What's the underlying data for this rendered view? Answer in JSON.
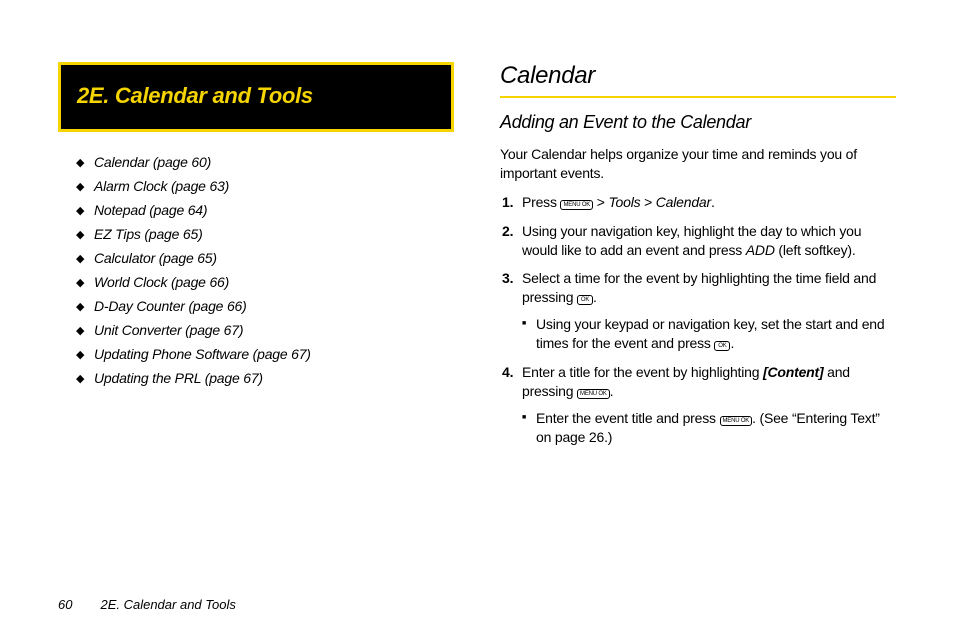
{
  "title": "2E.  Calendar and Tools",
  "bullets": [
    "Calendar (page 60)",
    "Alarm Clock (page 63)",
    "Notepad (page 64)",
    "EZ Tips (page 65)",
    "Calculator (page 65)",
    "World Clock (page 66)",
    "D-Day Counter (page 66)",
    "Unit Converter (page 67)",
    "Updating Phone Software (page 67)",
    "Updating the PRL (page 67)"
  ],
  "section": "Calendar",
  "subheading": "Adding an Event to the Calendar",
  "intro": "Your Calendar helps organize your time and reminds you of important events.",
  "key_menuok": "MENU\nOK",
  "key_ok": "OK",
  "step1_a": "Press ",
  "step1_b": " > ",
  "step1_tools": "Tools",
  "step1_gt": " > ",
  "step1_calendar": "Calendar",
  "step1_end": ".",
  "step2_a": "Using your navigation key, highlight the day to which you would like to add an event and press ",
  "step2_add": "ADD",
  "step2_b": " (left softkey).",
  "step3_a": "Select a time for the event by highlighting the time field and pressing ",
  "step3_end": ".",
  "step3_sub_a": "Using your keypad or navigation key, set the start and end times for the event and press ",
  "step3_sub_end": ".",
  "step4_a": "Enter a title for the event by highlighting ",
  "step4_content": "[Content]",
  "step4_b": " and pressing ",
  "step4_end": ".",
  "step4_sub_a": "Enter the event title and press ",
  "step4_sub_b": ". (See “Entering Text” on page 26.)",
  "footer_page": "60",
  "footer_text": "2E. Calendar and Tools"
}
